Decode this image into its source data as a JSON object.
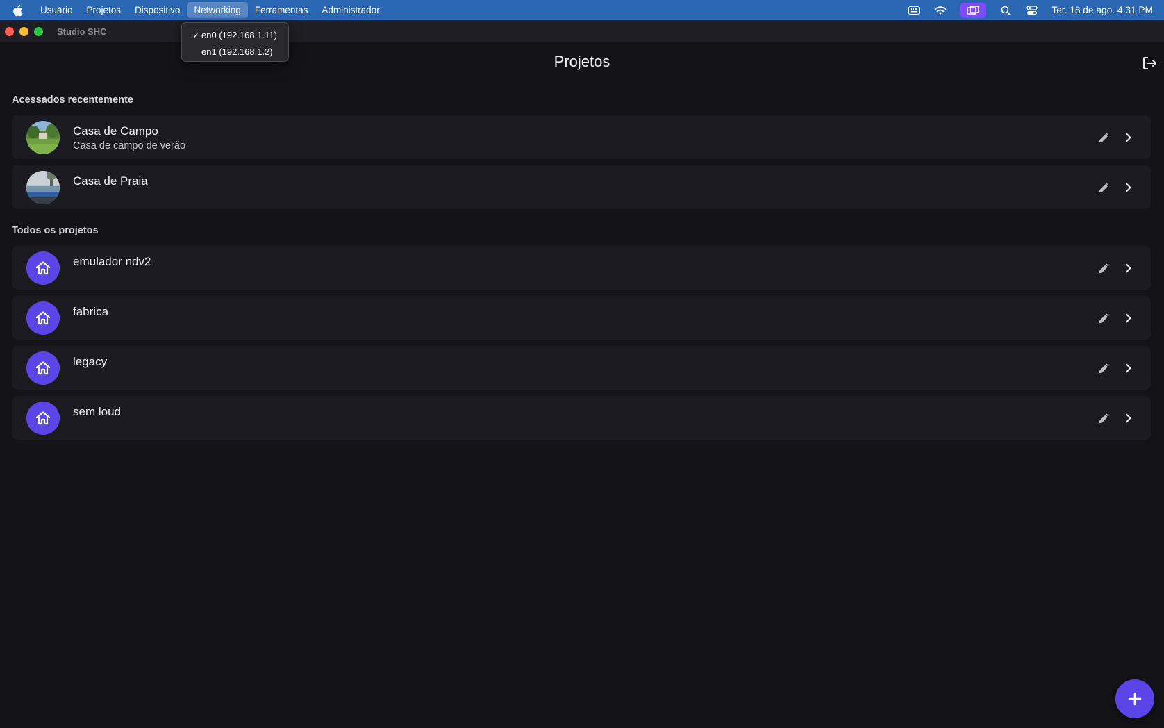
{
  "menubar": {
    "items": [
      "Usuário",
      "Projetos",
      "Dispositivo",
      "Networking",
      "Ferramentas",
      "Administrador"
    ],
    "active_index": 3,
    "clock": "Ter. 18 de ago.  4:31 PM",
    "icons": [
      "apple-icon",
      "keyboard-icon",
      "wifi-icon",
      "screen-mirroring-icon",
      "search-icon",
      "control-center-icon"
    ],
    "bg_color": "#2b66b3",
    "highlight_color": "#7c4dff"
  },
  "window": {
    "title": "Studio SHC"
  },
  "dropdown": {
    "items": [
      {
        "check": "✓",
        "label": "en0 (192.168.1.11)"
      },
      {
        "check": "",
        "label": "en1 (192.168.1.2)"
      }
    ]
  },
  "page": {
    "title": "Projetos",
    "recent_label": "Acessados recentemente",
    "all_label": "Todos os projetos"
  },
  "recent_projects": [
    {
      "title": "Casa de Campo",
      "subtitle": "Casa de campo de verão",
      "avatar": "photo-landscape"
    },
    {
      "title": "Casa de Praia",
      "subtitle": "",
      "avatar": "photo-beach"
    }
  ],
  "all_projects": [
    {
      "title": "emulador ndv2",
      "avatar": "home-icon"
    },
    {
      "title": "fabrica",
      "avatar": "home-icon"
    },
    {
      "title": "legacy",
      "avatar": "home-icon"
    },
    {
      "title": "sem loud",
      "avatar": "home-icon"
    }
  ],
  "colors": {
    "accent": "#5b45e6",
    "background": "#141318",
    "card": "#1c1b21"
  }
}
